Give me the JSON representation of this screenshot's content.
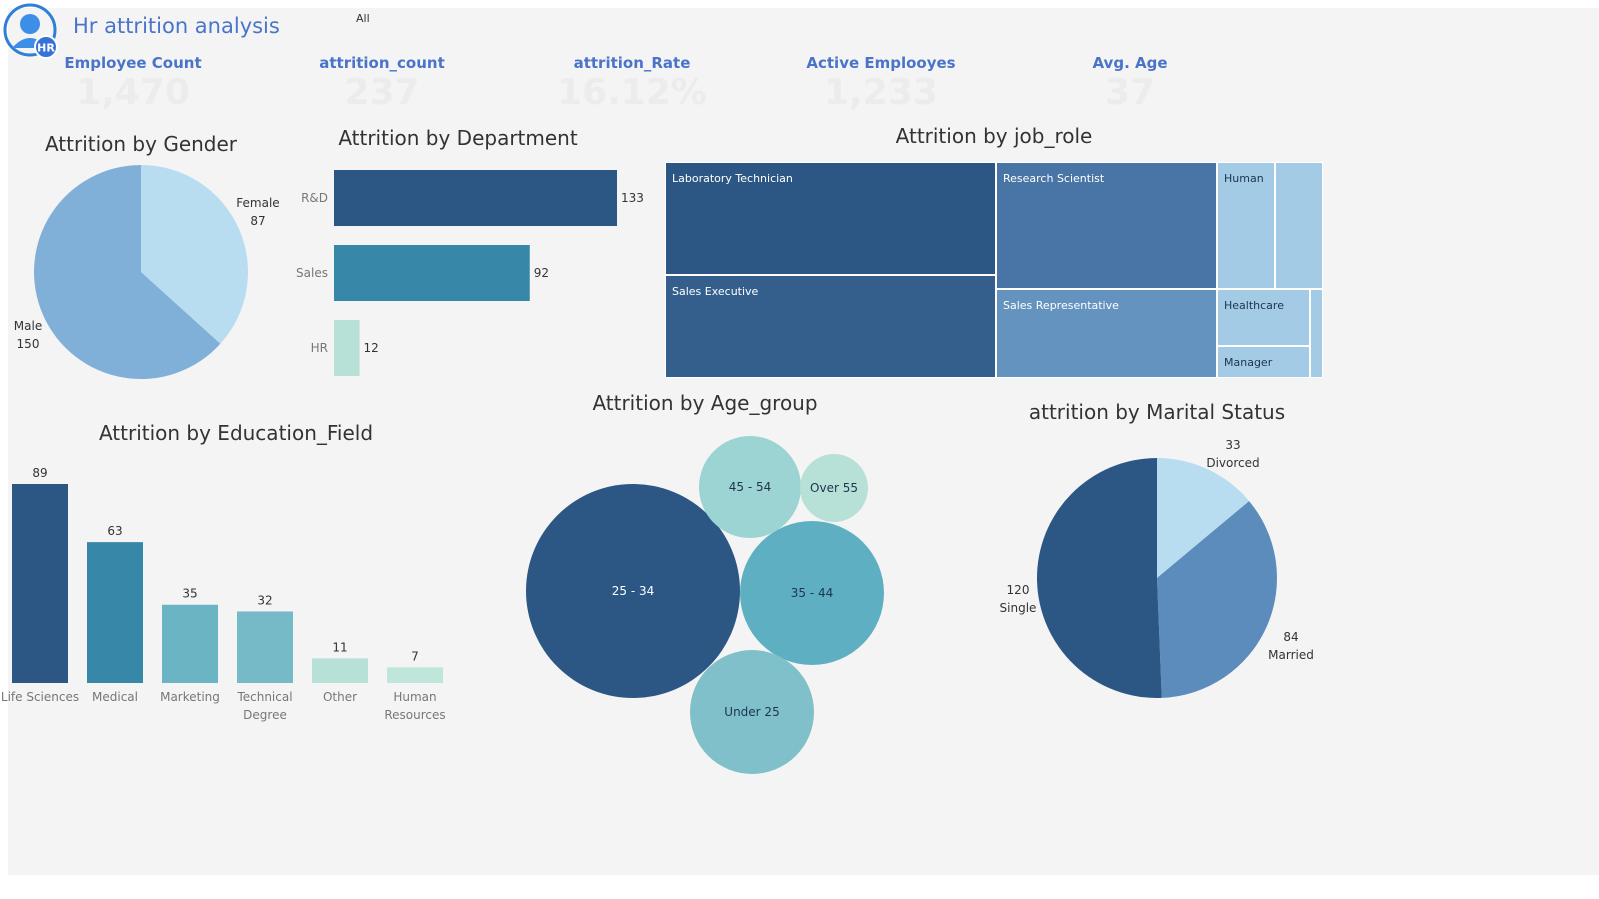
{
  "header": {
    "title": "Hr attrition analysis",
    "logo_badge": "HR",
    "filter_value": "All"
  },
  "kpis": [
    {
      "label": "Employee Count",
      "value": "1,470"
    },
    {
      "label": "attrition_count",
      "value": "237"
    },
    {
      "label": "attrition_Rate",
      "value": "16.12%"
    },
    {
      "label": "Active Emplooyes",
      "value": "1,233"
    },
    {
      "label": "Avg. Age",
      "value": "37"
    }
  ],
  "colors": {
    "accent": "#4a74c9",
    "dark_blue": "#2c5784",
    "teal": "#3787a8",
    "light_teal": "#b7e1d7",
    "canvas": "#f4f4f4"
  },
  "chart_data": [
    {
      "id": "gender",
      "type": "pie",
      "title": "Attrition by Gender",
      "categories": [
        "Female",
        "Male"
      ],
      "values": [
        87,
        150
      ],
      "colors": [
        "#b8ddf0",
        "#80b0d8"
      ]
    },
    {
      "id": "department",
      "type": "bar",
      "orientation": "horizontal",
      "title": "Attrition by Department",
      "categories": [
        "R&D",
        "Sales",
        "HR"
      ],
      "values": [
        133,
        92,
        12
      ],
      "colors": [
        "#2c5784",
        "#3787a8",
        "#b7e1d7"
      ]
    },
    {
      "id": "job_role",
      "type": "treemap",
      "title": "Attrition by job_role",
      "categories": [
        "Laboratory Technician",
        "Sales Executive",
        "Research Scientist",
        "Sales Representative",
        "Human",
        "Healthcare",
        "Manager"
      ],
      "colors": [
        "#2c5784",
        "#345f8c",
        "#4875a5",
        "#6593bf",
        "#a3cbe5",
        "#a3cbe5",
        "#a3cbe5"
      ]
    },
    {
      "id": "education",
      "type": "bar",
      "title": "Attrition by Education_Field",
      "categories": [
        "Life Sciences",
        "Medical",
        "Marketing",
        "Technical Degree",
        "Other",
        "Human Resources"
      ],
      "category_lines": [
        [
          "Life Sciences"
        ],
        [
          "Medical"
        ],
        [
          "Marketing"
        ],
        [
          "Technical",
          "Degree"
        ],
        [
          "Other"
        ],
        [
          "Human",
          "Resources"
        ]
      ],
      "values": [
        89,
        63,
        35,
        32,
        11,
        7
      ],
      "colors": [
        "#2c5784",
        "#3787a8",
        "#6ab4c4",
        "#76bac8",
        "#b7e1d7",
        "#c0e6dc"
      ]
    },
    {
      "id": "age_group",
      "type": "bubble",
      "title": "Attrition by Age_group",
      "categories": [
        "25 - 34",
        "35 - 44",
        "Under 25",
        "45 - 54",
        "Over 55"
      ],
      "colors": [
        "#2c5784",
        "#5fafc3",
        "#7fc0ca",
        "#9cd3d3",
        "#b7e1d7"
      ]
    },
    {
      "id": "marital",
      "type": "pie",
      "title": "attrition by Marital Status",
      "categories": [
        "Divorced",
        "Married",
        "Single"
      ],
      "values": [
        33,
        84,
        120
      ],
      "colors": [
        "#b8ddf0",
        "#5b8cbb",
        "#2c5784"
      ]
    }
  ]
}
